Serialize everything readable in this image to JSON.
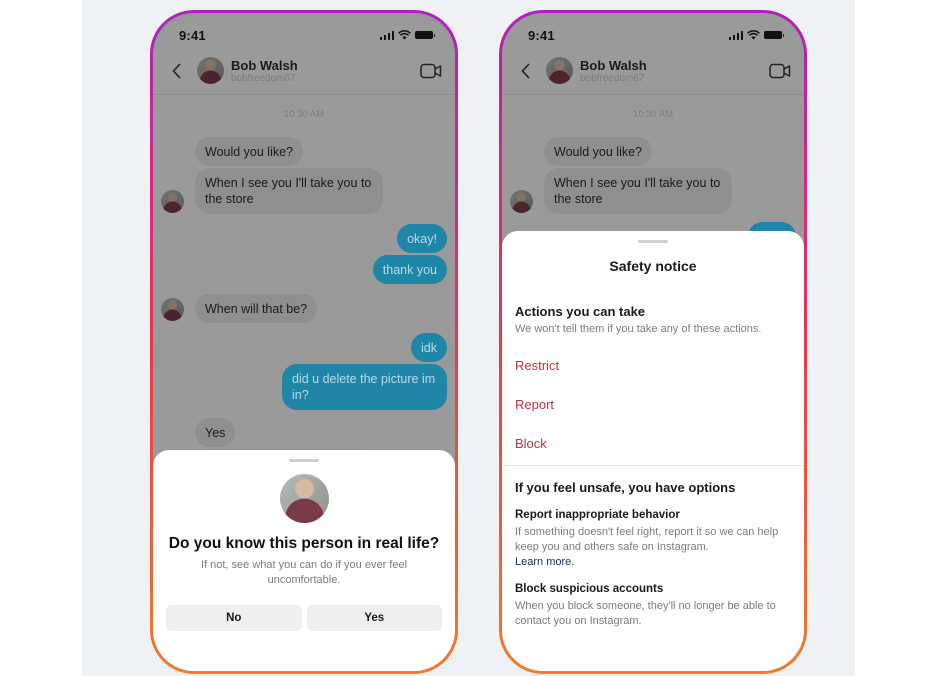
{
  "status_bar": {
    "time": "9:41"
  },
  "header": {
    "name": "Bob Walsh",
    "username": "bobfreedom67"
  },
  "chat": {
    "timestamp": "10:30 AM",
    "messages": [
      {
        "from": "them",
        "text": "Would you like?"
      },
      {
        "from": "them",
        "text": "When I see you I'll take you to the store"
      },
      {
        "from": "me",
        "text": "okay!"
      },
      {
        "from": "me",
        "text": "thank you"
      },
      {
        "from": "them",
        "text": "When will that be?"
      },
      {
        "from": "me",
        "text": "idk"
      },
      {
        "from": "me",
        "text": "did u delete the picture im in?"
      },
      {
        "from": "them",
        "text": "Yes"
      }
    ]
  },
  "question_sheet": {
    "title": "Do you know this person in real life?",
    "subtitle": "If not, see what you can do if you ever feel uncomfortable.",
    "no_label": "No",
    "yes_label": "Yes"
  },
  "safety_sheet": {
    "title": "Safety notice",
    "actions_heading": "Actions you can take",
    "actions_note": "We won't tell them if you take any of these actions.",
    "actions": [
      "Restrict",
      "Report",
      "Block"
    ],
    "options_heading": "If you feel unsafe, you have options",
    "report_heading": "Report inappropriate behavior",
    "report_body": "If something doesn't feel right, report it so we can help keep you and others safe on Instagram.",
    "learn_more": "Learn more.",
    "block_heading": "Block suspicious accounts",
    "block_body": "When you block someone, they'll no longer be able to contact you on Instagram."
  },
  "colors": {
    "action_red": "#b83443",
    "sent_bubble": "#1f86a8",
    "link_navy": "#1d2d4f",
    "border_top": "#b01fc0",
    "border_bottom": "#ee7d2b"
  }
}
